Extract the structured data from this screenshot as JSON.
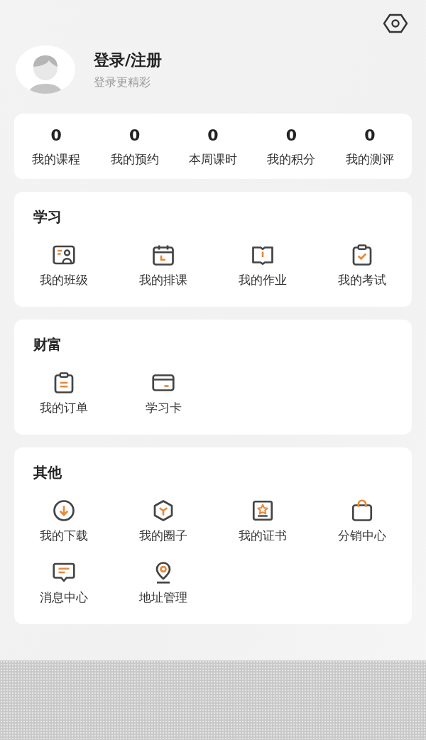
{
  "profile": {
    "title": "登录/注册",
    "subtitle": "登录更精彩"
  },
  "stats": [
    {
      "value": "0",
      "label": "我的课程"
    },
    {
      "value": "0",
      "label": "我的预约"
    },
    {
      "value": "0",
      "label": "本周课时"
    },
    {
      "value": "0",
      "label": "我的积分"
    },
    {
      "value": "0",
      "label": "我的测评"
    }
  ],
  "sections": [
    {
      "title": "学习",
      "items": [
        "我的班级",
        "我的排课",
        "我的作业",
        "我的考试"
      ]
    },
    {
      "title": "财富",
      "items": [
        "我的订单",
        "学习卡"
      ]
    },
    {
      "title": "其他",
      "items": [
        "我的下载",
        "我的圈子",
        "我的证书",
        "分销中心",
        "消息中心",
        "地址管理"
      ]
    }
  ]
}
